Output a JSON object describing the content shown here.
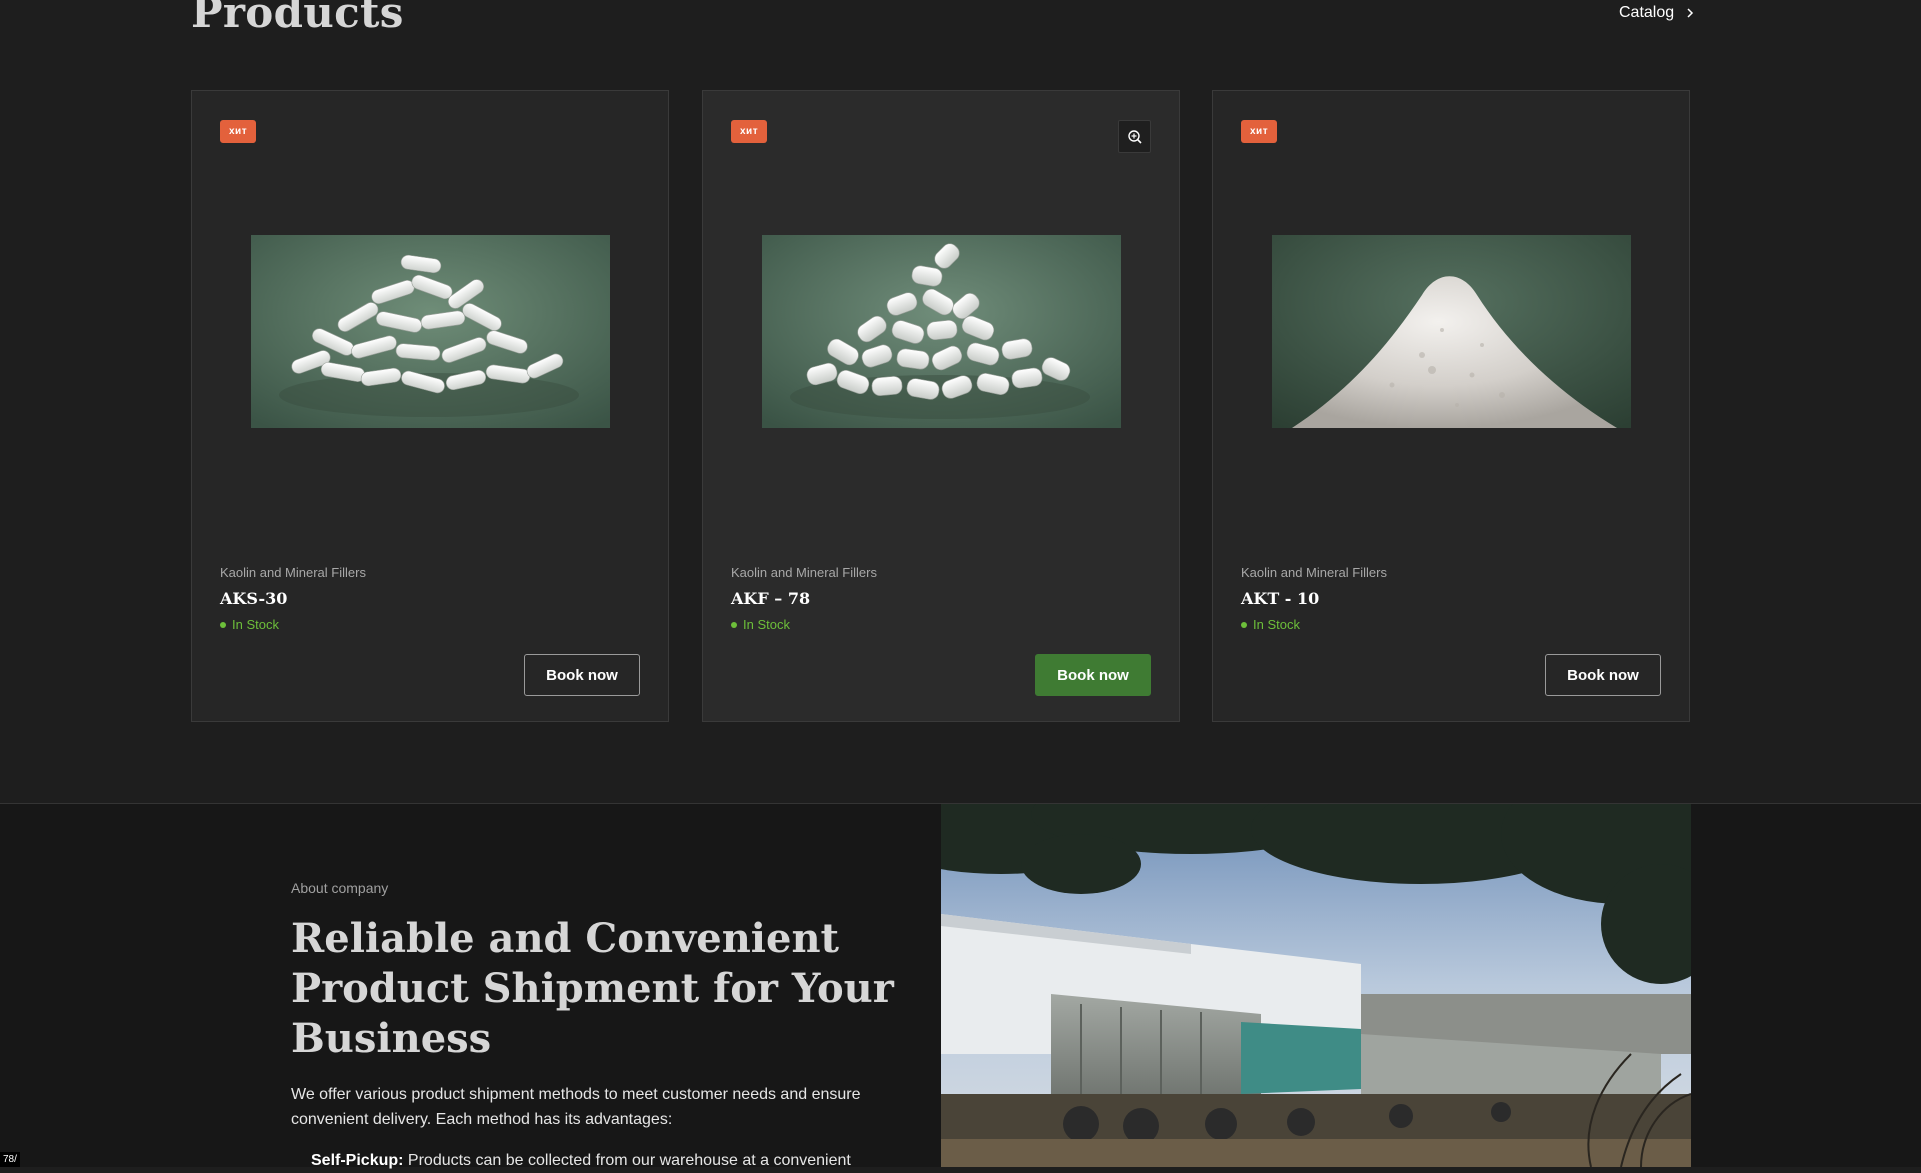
{
  "products": {
    "title": "Products",
    "catalog_label": "Catalog",
    "items": [
      {
        "badge": "хит",
        "category": "Kaolin and Mineral Fillers",
        "name": "AKS-30",
        "stock": "In Stock",
        "button": "Book now",
        "image_icon": "kaolin-pellets-image"
      },
      {
        "badge": "хит",
        "category": "Kaolin and Mineral Fillers",
        "name": "AKF – 78",
        "stock": "In Stock",
        "button": "Book now",
        "image_icon": "kaolin-pellets-image"
      },
      {
        "badge": "хит",
        "category": "Kaolin and Mineral Fillers",
        "name": "AKT - 10",
        "stock": "In Stock",
        "button": "Book now",
        "image_icon": "kaolin-powder-image"
      }
    ]
  },
  "about": {
    "eyebrow": "About company",
    "heading": "Reliable and Convenient Product Shipment for Your Business",
    "text": "We offer various product shipment methods to meet customer needs and ensure convenient delivery. Each method has its advantages:",
    "list_item_label": "Self-Pickup:",
    "list_item_text": " Products can be collected from our warehouse at a convenient"
  },
  "page_counter": "78/",
  "colors": {
    "accent_badge": "#e3613c",
    "stock_green": "#6dbf3a",
    "button_green": "#3f7b33",
    "background": "#1e1e1e"
  }
}
